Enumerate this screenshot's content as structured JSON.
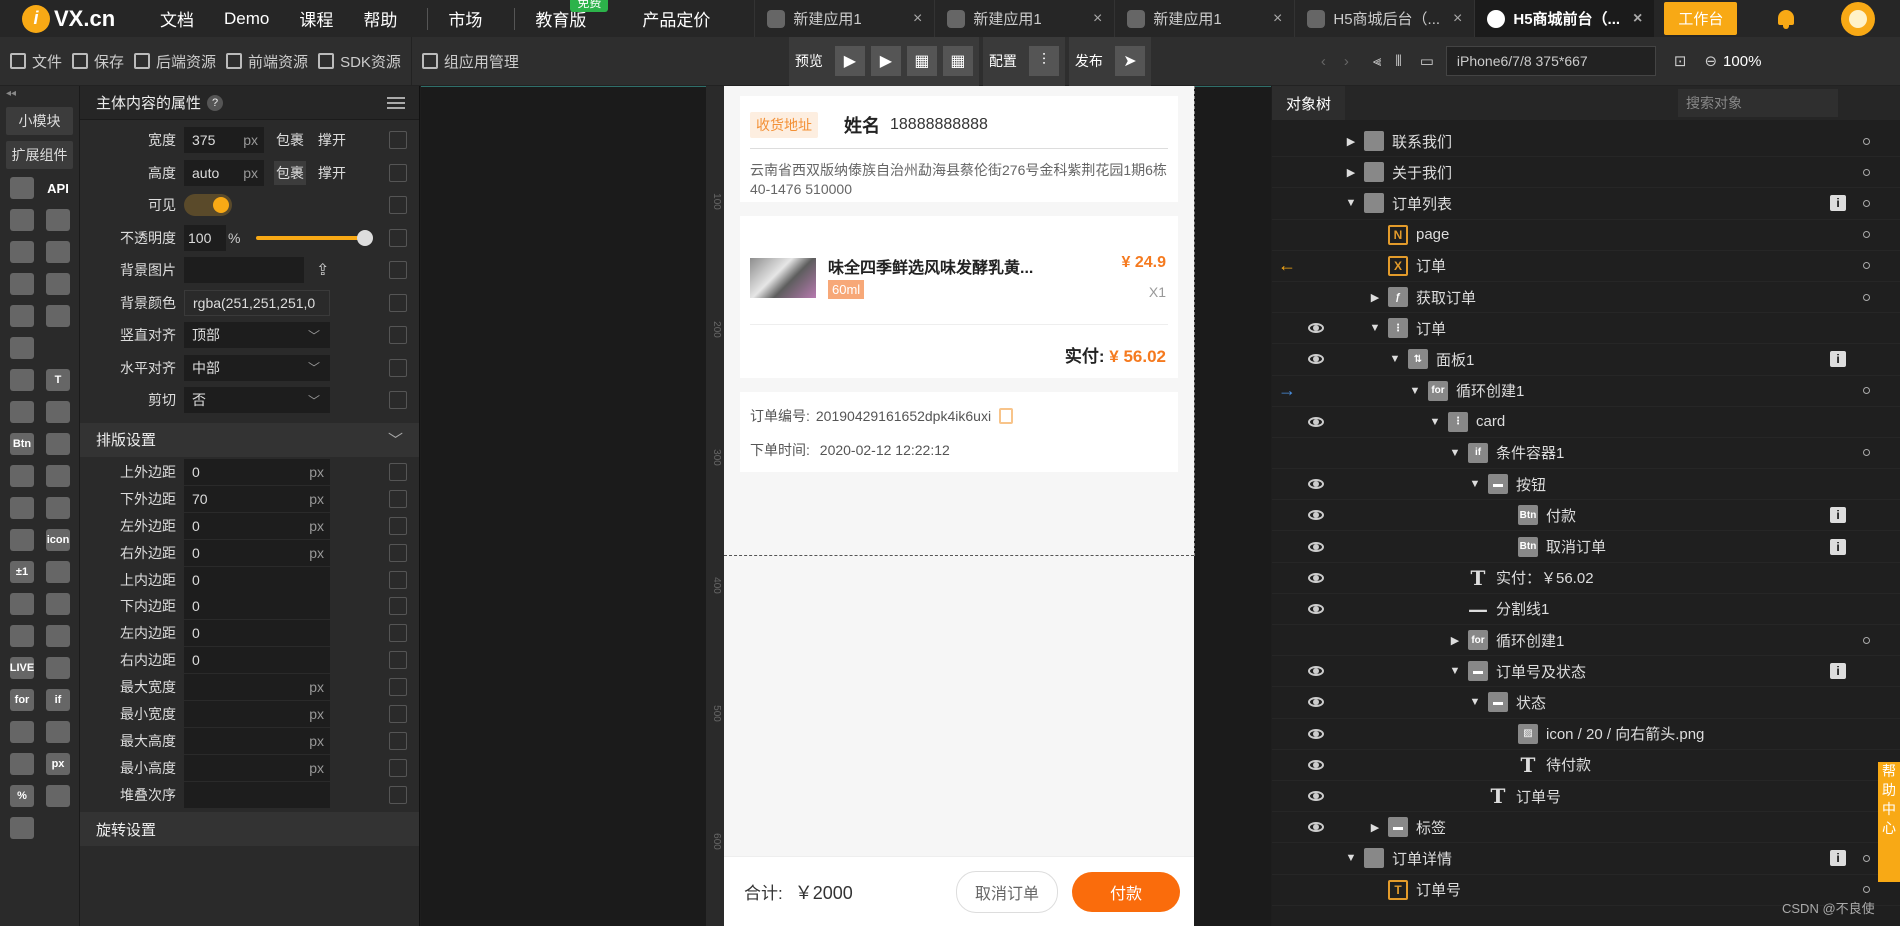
{
  "header": {
    "logo_badge": "i",
    "logo_text": "VX.cn",
    "nav": [
      "文档",
      "Demo",
      "课程",
      "帮助"
    ],
    "market": "市场",
    "edu": "教育版",
    "edu_badge": "免费",
    "pricing": "产品定价",
    "tabs": [
      {
        "label": "新建应用1",
        "close": "×"
      },
      {
        "label": "新建应用1",
        "close": "×"
      },
      {
        "label": "新建应用1",
        "close": "×"
      },
      {
        "label": "H5商城后台（...",
        "close": "×"
      },
      {
        "label": "H5商城前台（...",
        "close": "×"
      }
    ],
    "workbench": "工作台"
  },
  "toolbar": {
    "file": "文件",
    "save": "保存",
    "backend": "后端资源",
    "frontend": "前端资源",
    "sdk": "SDK资源",
    "component_mgmt": "组应用管理",
    "preview": "预览",
    "config": "配置",
    "publish": "发布",
    "device": "iPhone6/7/8 375*667",
    "zoom": "100%"
  },
  "left_rail": {
    "tag1": "小模块",
    "tag2": "扩展组件",
    "api": "API",
    "icons": [
      "box-icon",
      "api-label",
      "nodes-icon",
      "cloud-mqtt-icon",
      "gear-icon",
      "link-icon",
      "wechat-icon",
      "doc-upload-icon",
      "copy-icon",
      "list-icon",
      "download-icon",
      "spacer",
      "image-icon",
      "text-icon",
      "translate-icon",
      "edit-icon",
      "btn-icon",
      "music-icon",
      "video-icon",
      "media-icon",
      "form-icon",
      "ie-icon",
      "pin-icon",
      "icon-icon",
      "plusminus-icon",
      "qr-icon",
      "divider-icon",
      "image-link-icon",
      "bgimage-icon",
      "api-box-icon",
      "live-icon",
      "car-icon",
      "for-icon",
      "if-icon",
      "panel-icon",
      "dots-icon",
      "vertical-icon",
      "px-icon",
      "percent-icon",
      "sort-icon",
      "box2-icon"
    ]
  },
  "props": {
    "title": "主体内容的属性",
    "help": "?",
    "rows": [
      {
        "label": "宽度",
        "value": "375",
        "unit": "px",
        "b1": "包裹",
        "b2": "撑开"
      },
      {
        "label": "高度",
        "value": "auto",
        "unit": "px",
        "b1": "包裹",
        "b2": "撑开"
      },
      {
        "label": "可见"
      },
      {
        "label": "不透明度",
        "value": "100",
        "unit": "%"
      },
      {
        "label": "背景图片"
      },
      {
        "label": "背景颜色",
        "value": "rgba(251,251,251,0"
      },
      {
        "label": "竖直对齐",
        "value": "顶部"
      },
      {
        "label": "水平对齐",
        "value": "中部"
      },
      {
        "label": "剪切",
        "value": "否"
      }
    ],
    "layout_title": "排版设置",
    "layout_rows": [
      {
        "label": "上外边距",
        "value": "0",
        "unit": "px"
      },
      {
        "label": "下外边距",
        "value": "70",
        "unit": "px"
      },
      {
        "label": "左外边距",
        "value": "0",
        "unit": "px"
      },
      {
        "label": "右外边距",
        "value": "0",
        "unit": "px"
      },
      {
        "label": "上内边距",
        "value": "0",
        "unit": ""
      },
      {
        "label": "下内边距",
        "value": "0",
        "unit": ""
      },
      {
        "label": "左内边距",
        "value": "0",
        "unit": ""
      },
      {
        "label": "右内边距",
        "value": "0",
        "unit": ""
      },
      {
        "label": "最大宽度",
        "value": "",
        "unit": "px"
      },
      {
        "label": "最小宽度",
        "value": "",
        "unit": "px"
      },
      {
        "label": "最大高度",
        "value": "",
        "unit": "px"
      },
      {
        "label": "最小高度",
        "value": "",
        "unit": "px"
      },
      {
        "label": "堆叠次序",
        "value": "",
        "unit": ""
      }
    ],
    "bottom_section": "旋转设置"
  },
  "phone": {
    "addr_tag": "收货地址",
    "name": "姓名",
    "phone": "18888888888",
    "address": "云南省西双版纳傣族自治州勐海县蔡伦街276号金科紫荆花园1期6栋40-1476 510000",
    "product": "味全四季鲜选风味发酵乳黄...",
    "price": "¥ 24.9",
    "spec": "60ml",
    "qty": "X1",
    "paid_label": "实付:",
    "paid_value": "¥ 56.02",
    "order_no_label": "订单编号:",
    "order_no": "20190429161652dpk4ik6uxi",
    "order_time_label": "下单时间:",
    "order_time": "2020-02-12 12:22:12",
    "total_label": "合计:",
    "total_value": "￥2000",
    "cancel_btn": "取消订单",
    "pay_btn": "付款",
    "ruler_marks": [
      "100",
      "200",
      "300",
      "400",
      "500",
      "600"
    ]
  },
  "tree": {
    "tab": "对象树",
    "search_placeholder": "搜索对象",
    "nodes": [
      {
        "label": "联系我们",
        "eye": false,
        "tri": "▶",
        "indent": 72,
        "icon": "page"
      },
      {
        "label": "关于我们",
        "eye": false,
        "tri": "▶",
        "indent": 72,
        "icon": "page"
      },
      {
        "label": "订单列表",
        "eye": false,
        "tri": "▼",
        "indent": 72,
        "icon": "page",
        "info": true
      },
      {
        "label": "page",
        "eye": false,
        "tri": "",
        "indent": 96,
        "icon": "N"
      },
      {
        "label": "订单",
        "eye": false,
        "tri": "",
        "indent": 96,
        "icon": "X",
        "arrow": "←"
      },
      {
        "label": "获取订单",
        "eye": false,
        "tri": "▶",
        "indent": 96,
        "icon": "fn"
      },
      {
        "label": "订单",
        "eye": true,
        "tri": "▼",
        "indent": 96,
        "icon": "col"
      },
      {
        "label": "面板1",
        "eye": true,
        "tri": "▼",
        "indent": 116,
        "icon": "panel",
        "info": true
      },
      {
        "label": "循环创建1",
        "eye": false,
        "tri": "▼",
        "indent": 136,
        "icon": "for",
        "arrow": "→"
      },
      {
        "label": "card",
        "eye": true,
        "tri": "▼",
        "indent": 156,
        "icon": "col"
      },
      {
        "label": "条件容器1",
        "eye": false,
        "tri": "▼",
        "indent": 176,
        "icon": "if"
      },
      {
        "label": "按钮",
        "eye": true,
        "tri": "▼",
        "indent": 196,
        "icon": "row"
      },
      {
        "label": "付款",
        "eye": true,
        "tri": "",
        "indent": 226,
        "icon": "Btn",
        "info": true
      },
      {
        "label": "取消订单",
        "eye": true,
        "tri": "",
        "indent": 226,
        "icon": "Btn",
        "info": true
      },
      {
        "label": "实付：￥56.02",
        "eye": true,
        "tri": "",
        "indent": 176,
        "icon": "T"
      },
      {
        "label": "分割线1",
        "eye": true,
        "tri": "",
        "indent": 176,
        "icon": "line"
      },
      {
        "label": "循环创建1",
        "eye": false,
        "tri": "▶",
        "indent": 176,
        "icon": "for"
      },
      {
        "label": "订单号及状态",
        "eye": true,
        "tri": "▼",
        "indent": 176,
        "icon": "row",
        "info": true
      },
      {
        "label": "状态",
        "eye": true,
        "tri": "▼",
        "indent": 196,
        "icon": "row"
      },
      {
        "label": "icon / 20 / 向右箭头.png",
        "eye": true,
        "tri": "",
        "indent": 226,
        "icon": "img"
      },
      {
        "label": "待付款",
        "eye": true,
        "tri": "",
        "indent": 226,
        "icon": "T"
      },
      {
        "label": "订单号",
        "eye": true,
        "tri": "",
        "indent": 196,
        "icon": "T"
      },
      {
        "label": "标签",
        "eye": true,
        "tri": "▶",
        "indent": 96,
        "icon": "row"
      },
      {
        "label": "订单详情",
        "eye": false,
        "tri": "▼",
        "indent": 72,
        "icon": "page",
        "info": true
      },
      {
        "label": "订单号",
        "eye": false,
        "tri": "",
        "indent": 96,
        "icon": "T2"
      }
    ]
  },
  "help_strip": "帮助中心",
  "watermark": "CSDN @不良使"
}
